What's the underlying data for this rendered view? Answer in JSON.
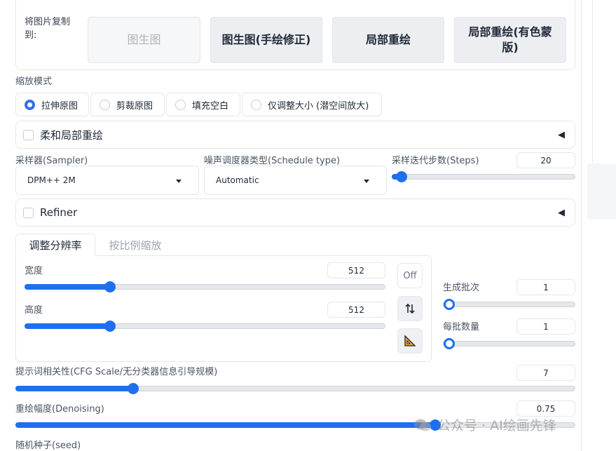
{
  "copy_to": {
    "label": "将图片复制到:",
    "buttons": [
      {
        "label": "图生图",
        "state": "disabled"
      },
      {
        "label": "图生图(手绘修正)",
        "state": "normal"
      },
      {
        "label": "局部重绘",
        "state": "normal"
      },
      {
        "label": "局部重绘(有色蒙版)",
        "state": "normal"
      }
    ]
  },
  "resize_mode": {
    "label": "缩放模式",
    "options": [
      "拉伸原图",
      "剪裁原图",
      "填充空白",
      "仅调整大小 (潜空间放大)"
    ],
    "selected": "拉伸原图"
  },
  "soft_inpaint": {
    "label": "柔和局部重绘",
    "checked": false
  },
  "sampler": {
    "label": "采样器(Sampler)",
    "value": "DPM++ 2M"
  },
  "schedule_type": {
    "label": "噪声调度器类型(Schedule type)",
    "value": "Automatic"
  },
  "steps": {
    "label": "采样迭代步数(Steps)",
    "value": "20",
    "fraction": 0.05
  },
  "refiner": {
    "label": "Refiner",
    "checked": false
  },
  "tabs": [
    {
      "label": "调整分辨率",
      "active": true
    },
    {
      "label": "按比例缩放",
      "active": false
    }
  ],
  "width": {
    "label": "宽度",
    "value": "512",
    "fraction": 0.235
  },
  "height": {
    "label": "高度",
    "value": "512",
    "fraction": 0.235
  },
  "tools": {
    "off_label": "Off",
    "swap_icon": "swap-icon",
    "ruler_icon": "ruler-triangle-icon"
  },
  "batch_count": {
    "label": "生成批次",
    "value": "1",
    "fraction": 0.0
  },
  "batch_size": {
    "label": "每批数量",
    "value": "1",
    "fraction": 0.0
  },
  "cfg_scale": {
    "label": "提示词相关性(CFG Scale/无分类器信息引导规模)",
    "value": "7",
    "fraction": 0.21
  },
  "denoising": {
    "label": "重绘幅度(Denoising)",
    "value": "0.75",
    "fraction": 0.75
  },
  "seed": {
    "label": "随机种子(seed)"
  },
  "watermark": {
    "text": "公众号 · AI绘画先锋"
  },
  "colors": {
    "accent": "#1f6fef",
    "border": "#e5e7eb",
    "button_bg": "#eceef1"
  }
}
